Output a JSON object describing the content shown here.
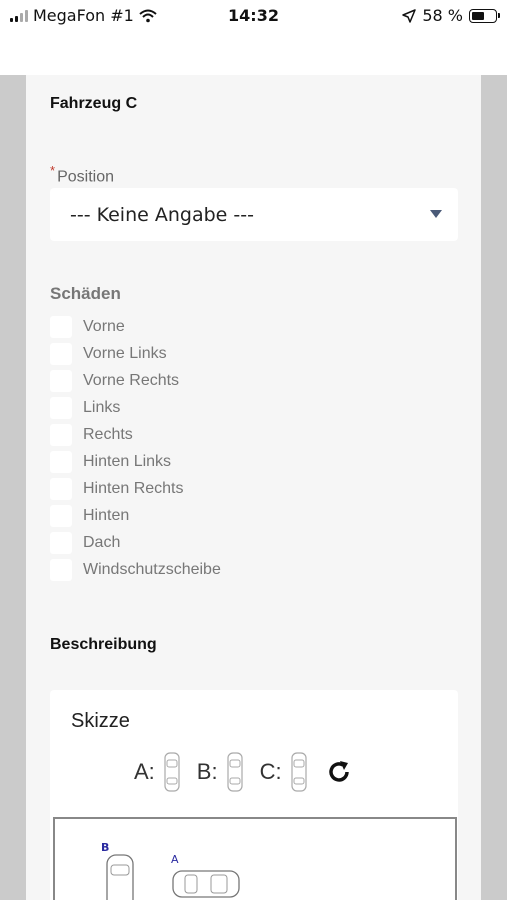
{
  "status_bar": {
    "carrier": "MegaFon #1",
    "time": "14:32",
    "battery": "58 %",
    "battery_level": 0.58
  },
  "section_title": "Fahrzeug C",
  "position": {
    "label": "Position",
    "required_mark": "*",
    "selected": "--- Keine Angabe ---"
  },
  "damages": {
    "label": "Schäden",
    "options": [
      "Vorne",
      "Vorne Links",
      "Vorne Rechts",
      "Links",
      "Rechts",
      "Hinten Links",
      "Hinten Rechts",
      "Hinten",
      "Dach",
      "Windschutzscheibe"
    ]
  },
  "description_label": "Beschreibung",
  "sketch": {
    "title": "Skizze",
    "vehicles": [
      "A:",
      "B:",
      "C:"
    ],
    "canvas_labels": {
      "b": "B",
      "a": "A"
    }
  }
}
